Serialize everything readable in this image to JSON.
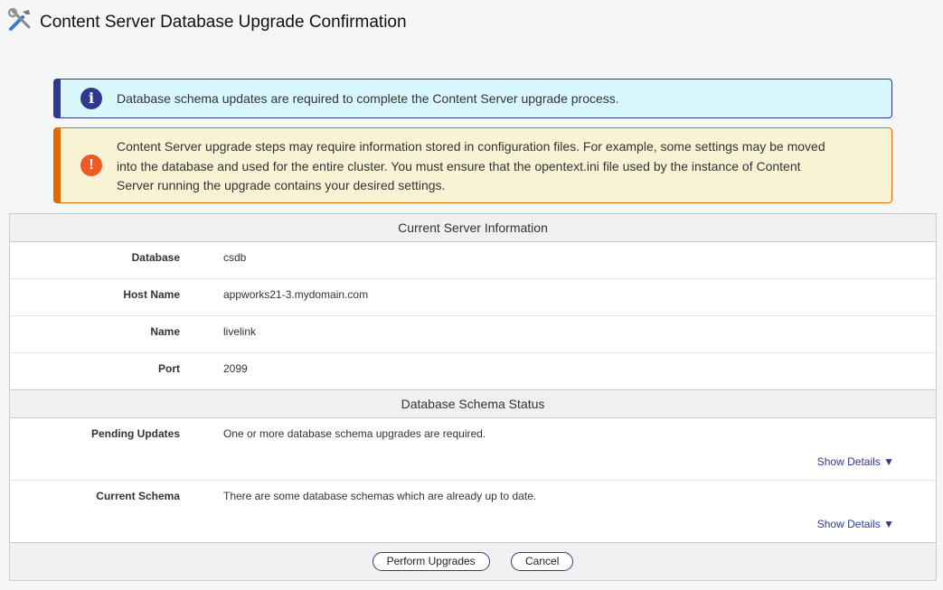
{
  "header": {
    "title": "Content Server Database Upgrade Confirmation",
    "icon": "tools-icon"
  },
  "alerts": {
    "info": {
      "icon": "info-icon",
      "text": "Database schema updates are required to complete the Content Server upgrade process.",
      "color": "#2f3a8f"
    },
    "warning": {
      "icon": "exclamation-icon",
      "text": "Content Server upgrade steps may require information stored in configuration files. For example, some settings may be moved into the database and used for the entire cluster. You must ensure that the opentext.ini file used by the instance of Content Server running the upgrade contains your desired settings.",
      "color": "#e06b00"
    }
  },
  "server_info": {
    "title": "Current Server Information",
    "rows": [
      {
        "label": "Database",
        "value": "csdb"
      },
      {
        "label": "Host Name",
        "value": "appworks21-3.mydomain.com"
      },
      {
        "label": "Name",
        "value": "livelink"
      },
      {
        "label": "Port",
        "value": "2099"
      }
    ]
  },
  "schema_status": {
    "title": "Database Schema Status",
    "rows": [
      {
        "label": "Pending Updates",
        "value": "One or more database schema upgrades are required.",
        "details": "Show Details ▼"
      },
      {
        "label": "Current Schema",
        "value": "There are some database schemas which are already up to date.",
        "details": "Show Details ▼"
      }
    ]
  },
  "buttons": {
    "perform": "Perform Upgrades",
    "cancel": "Cancel"
  }
}
